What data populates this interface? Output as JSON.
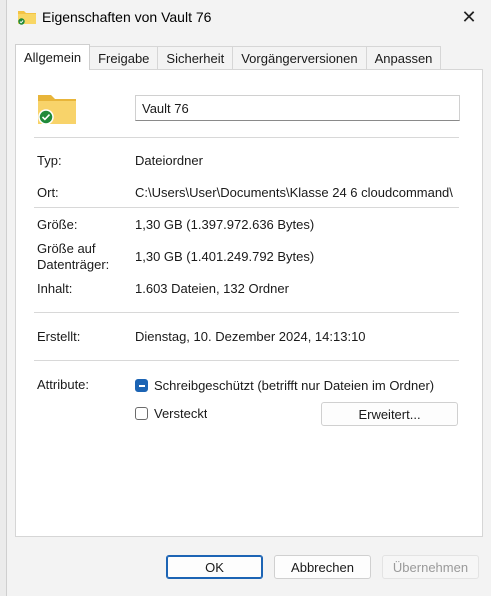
{
  "window": {
    "title": "Eigenschaften von Vault 76",
    "close_icon": "close-icon"
  },
  "tabs": [
    {
      "label": "Allgemein",
      "active": true
    },
    {
      "label": "Freigabe",
      "active": false
    },
    {
      "label": "Sicherheit",
      "active": false
    },
    {
      "label": "Vorgängerversionen",
      "active": false
    },
    {
      "label": "Anpassen",
      "active": false
    }
  ],
  "general": {
    "name": "Vault 76",
    "type_label": "Typ:",
    "type_value": "Dateiordner",
    "location_label": "Ort:",
    "location_value": "C:\\Users\\User\\Documents\\Klasse 24 6 cloudcommand\\",
    "size_label": "Größe:",
    "size_value": "1,30 GB (1.397.972.636 Bytes)",
    "disk_size_label": "Größe auf Datenträger:",
    "disk_size_value": "1,30 GB (1.401.249.792 Bytes)",
    "contents_label": "Inhalt:",
    "contents_value": "1.603 Dateien, 132 Ordner",
    "created_label": "Erstellt:",
    "created_value": "Dienstag, 10. Dezember 2024, 14:13:10",
    "attributes_label": "Attribute:",
    "readonly_label": "Schreibgeschützt (betrifft nur Dateien im Ordner)",
    "readonly_state": "indeterminate",
    "hidden_label": "Versteckt",
    "hidden_state": "unchecked",
    "advanced_button": "Erweitert..."
  },
  "footer": {
    "ok": "OK",
    "cancel": "Abbrechen",
    "apply": "Übernehmen"
  },
  "colors": {
    "accent": "#1c64b4",
    "folder": "#f3c344",
    "sync_badge": "#1f8a3a"
  }
}
